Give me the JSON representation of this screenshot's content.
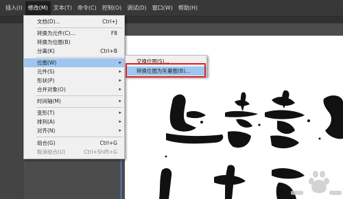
{
  "menubar": {
    "items": [
      "插入(I)",
      "修改(M)",
      "文本(T)",
      "命令(C)",
      "控制(O)",
      "调试(D)",
      "窗口(W)",
      "帮助(H)"
    ]
  },
  "menu": {
    "items": [
      {
        "label": "文档(D)...",
        "shortcut": "Ctrl+J"
      },
      {
        "label": "转换为元件(C)...",
        "shortcut": "F8"
      },
      {
        "label": "转换为位图(B)",
        "shortcut": ""
      },
      {
        "label": "分离(K)",
        "shortcut": "Ctrl+B"
      },
      {
        "label": "位图(W)",
        "shortcut": ""
      },
      {
        "label": "元件(S)",
        "shortcut": ""
      },
      {
        "label": "形状(P)",
        "shortcut": ""
      },
      {
        "label": "合并对象(O)",
        "shortcut": ""
      },
      {
        "label": "时间轴(M)",
        "shortcut": ""
      },
      {
        "label": "变形(T)",
        "shortcut": ""
      },
      {
        "label": "排列(A)",
        "shortcut": ""
      },
      {
        "label": "对齐(N)",
        "shortcut": ""
      },
      {
        "label": "组合(G)",
        "shortcut": "Ctrl+G"
      },
      {
        "label": "取消组合(U)",
        "shortcut": "Ctrl+Shift+G"
      }
    ]
  },
  "submenu": {
    "items": [
      {
        "label": "交换位图(S)..."
      },
      {
        "label": "转换位图为矢量图(B)..."
      }
    ]
  },
  "colors": {
    "highlight": "#9ec6ef",
    "annotation_box": "#e02020",
    "guide": "#5aa0ff"
  }
}
